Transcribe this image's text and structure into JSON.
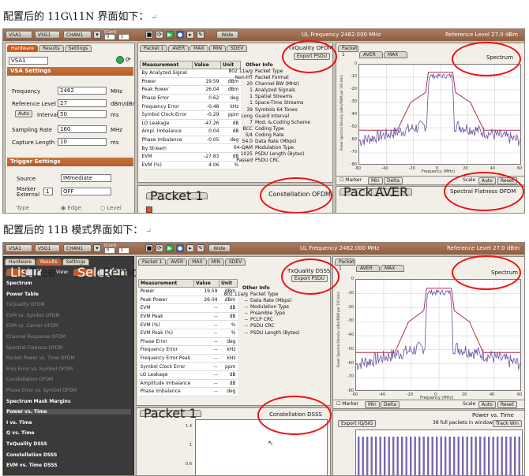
{
  "caption1": "配置后的 11G\\11N 界面如下：",
  "caption2": "配置后的 11B 模式界面如下：",
  "return_mark": "↵",
  "toolbar": {
    "tabs": [
      "VSA1",
      "VSG1",
      "CHAN1"
    ],
    "spin_label": "(Cont)",
    "spin_values": [
      "0",
      "1"
    ],
    "wide_label": "Wide",
    "ul_frequency": "UL Frequency  2462.000 MHz",
    "reference_level": "Reference Level  27.0 dBm"
  },
  "shot1": {
    "left_tabs": [
      "Hardware",
      "Results",
      "Settings"
    ],
    "vsa_select": "VSA1",
    "vsa_section": "VSA Settings",
    "fields": [
      {
        "label": "Frequency",
        "value": "2462",
        "unit": "MHz"
      },
      {
        "label": "Reference Level",
        "value": "27",
        "unit": "dBm/dBr"
      },
      {
        "label": "Interval",
        "value": "50",
        "unit": "ms"
      },
      {
        "label": "Sampling Rate",
        "value": "160",
        "unit": "MHz"
      },
      {
        "label": "Capture Length",
        "value": "10",
        "unit": "ms"
      }
    ],
    "trigger_section": "Trigger Settings",
    "trigger_source_label": "Source",
    "trigger_source_value": "IMmediate",
    "trigger_marker_label": "Marker External",
    "trigger_marker_num": "1",
    "trigger_marker_value": "OFF",
    "trigger_type_label": "Type",
    "trigger_type_options": [
      "Edge",
      "Level"
    ],
    "packet_tabs": [
      "Packet 1",
      "AVER",
      "MAX",
      "MIN",
      "SDEV"
    ],
    "panel_title": "TxQuality OFDM",
    "export_label": "Export PSDU",
    "table_headers": [
      "Measurement",
      "Value",
      "Unit"
    ],
    "rows": [
      [
        "By Analyzed Signal",
        "",
        ""
      ],
      [
        "Power",
        "19.59",
        "dBm"
      ],
      [
        "Peak Power",
        "26.04",
        "dBm"
      ],
      [
        "Phase Error",
        "0.62",
        "deg"
      ],
      [
        "Frequency Error",
        "-0.48",
        "kHz"
      ],
      [
        "Symbol Clock Error",
        "-0.29",
        "ppm"
      ],
      [
        "LO Leakage",
        "-47.26",
        "dB"
      ],
      [
        "Ampl. Imbalance",
        "0.04",
        "dB"
      ],
      [
        "Phase Imbalance",
        "-0.05",
        "deg"
      ],
      [
        "By Stream",
        "",
        ""
      ],
      [
        "EVM",
        "-27.83",
        "dB"
      ],
      [
        "EVM (%)",
        "4.06",
        "%"
      ]
    ],
    "other_info_title": "Other Info",
    "other_info": [
      [
        "802.11a/g",
        "Packet Type"
      ],
      [
        "Non-HT",
        "Packet Format"
      ],
      [
        "20",
        "Channel BW (MHz)"
      ],
      [
        "1",
        "Analyzed Signals"
      ],
      [
        "1",
        "Spatial Streams"
      ],
      [
        "1",
        "Space-Time Streams"
      ],
      [
        "39",
        "Symbols   64  Tones"
      ],
      [
        "Long",
        "Guard Interval"
      ],
      [
        "7",
        "Mod. & Coding Scheme"
      ],
      [
        "BCC",
        "Coding Type"
      ],
      [
        "3/4",
        "Coding Rate"
      ],
      [
        "54.0",
        "Data Rate (Mbps)"
      ],
      [
        "64-QAM",
        "Modulation Type"
      ],
      [
        "1025",
        "PSDU Length (Bytes)"
      ],
      [
        "Passed",
        "PSDU CRC"
      ]
    ],
    "bottom_packet": "Packet 1",
    "bottom_title": "Constellation OFDM",
    "spectrum_tabs": [
      "Packet 1",
      "AVER",
      "MAX"
    ],
    "spectrum_title": "Spectrum",
    "spectrum_ylabel": "Power Spectral Density (dBm/RBW per 100 kHz)",
    "spectrum_yticks": [
      "0",
      "-10",
      "-20",
      "-30",
      "-40",
      "-50",
      "-60",
      "-70",
      "-80"
    ],
    "spectrum_xticks": [
      "-60",
      "-40",
      "-20",
      "0",
      "20",
      "40",
      "60"
    ],
    "spectrum_xlabel": "Frequency (MHz)",
    "marker_items": [
      "Marker",
      "Min",
      "Delta"
    ],
    "scale_label": "Scale",
    "scale_buttons": [
      "Auto",
      "Reset"
    ],
    "flatness_packet": "Packet 1",
    "flatness_tab": "AVER",
    "flatness_title": "Spectral Flatness OFDM"
  },
  "shot2": {
    "left_tabs": [
      "Hardware",
      "Results",
      "Settings"
    ],
    "view_label": "View:",
    "view_buttons": [
      "List",
      "Tree"
    ],
    "action_buttons": [
      "Select",
      "Remove"
    ],
    "results_list": [
      "Spectrum",
      "Power Table",
      "TxQuality OFDM",
      "EVM vs. Symbol OFDM",
      "EVM vs. Carrier OFDM",
      "Channel Response OFDM",
      "Spectral Flatness OFDM",
      "Packet Power vs. Time OFDM",
      "Freq Error vs. Symbol OFDM",
      "Constellation OFDM",
      "Phase Error vs. Symbol OFDM",
      "Spectrum Mask Margins",
      "Power vs. Time",
      "I vs. Time",
      "Q vs. Time",
      "TxQuality DSSS",
      "Constellation DSSS",
      "EVM vs. Time DSSS"
    ],
    "packet_tabs": [
      "Packet 1",
      "AVER",
      "MAX",
      "MIN",
      "SDEV"
    ],
    "panel_title": "TxQuality DSSS",
    "export_label": "Export PSDU",
    "table_headers": [
      "Measurement",
      "Value",
      "Unit"
    ],
    "rows": [
      [
        "Power",
        "19.59",
        "dBm"
      ],
      [
        "Peak Power",
        "26.04",
        "dBm"
      ],
      [
        "EVM",
        "--",
        "dB"
      ],
      [
        "EVM Peak",
        "--",
        "dB"
      ],
      [
        "EVM (%)",
        "--",
        "%"
      ],
      [
        "EVM Peak (%)",
        "--",
        "%"
      ],
      [
        "Phase Error",
        "--",
        "deg"
      ],
      [
        "Frequency Error",
        "--",
        "kHz"
      ],
      [
        "Frequency Error Peak",
        "--",
        "kHz"
      ],
      [
        "Symbol Clock Error",
        "--",
        "ppm"
      ],
      [
        "LO Leakage",
        "--",
        "dB"
      ],
      [
        "Amplitude Imbalance",
        "--",
        "dB"
      ],
      [
        "Phase Imbalance",
        "--",
        "deg"
      ]
    ],
    "other_info_title": "Other Info",
    "other_info": [
      [
        "802.11a/g",
        "Packet Type"
      ],
      [
        "--",
        "Data Rate (Mbps)"
      ],
      [
        "--",
        "Modulation Type"
      ],
      [
        "--",
        "Preamble Type"
      ],
      [
        "--",
        "PCLP CRC"
      ],
      [
        "--",
        "PSDU CRC"
      ],
      [
        "--",
        "PSDU Length (Bytes)"
      ]
    ],
    "bottom_packet": "Packet 1",
    "bottom_title": "Constellation DSSS",
    "constellation_yticks": [
      "1.4",
      "1",
      "0.6"
    ],
    "spectrum_tabs": [
      "Packet 1",
      "AVER",
      "MAX"
    ],
    "spectrum_title": "Spectrum",
    "spectrum_ylabel": "Power Spectral Density (dBm/RBW per 100 kHz)",
    "spectrum_yticks": [
      "0",
      "-10",
      "-20",
      "-30",
      "-40",
      "-50",
      "-60",
      "-70",
      "-80"
    ],
    "spectrum_xticks": [
      "-60",
      "-40",
      "-20",
      "0",
      "20",
      "40",
      "60"
    ],
    "spectrum_xlabel": "Frequency (MHz)",
    "marker_items": [
      "Marker",
      "Min",
      "Delta"
    ],
    "scale_label": "Scale",
    "scale_buttons": [
      "Auto",
      "Reset"
    ],
    "pvt_title": "Power vs. Time",
    "pvt_export": "Export IQ/SIG",
    "pvt_packets": "38 full packets in window",
    "pvt_track": "Track Win"
  },
  "colors": {
    "accent": "#cc5a22",
    "toolbar": "#9a6a4e",
    "spectrum_line": "#6a4fa0",
    "mask_line": "#b03050",
    "annotation": "#e11111"
  }
}
